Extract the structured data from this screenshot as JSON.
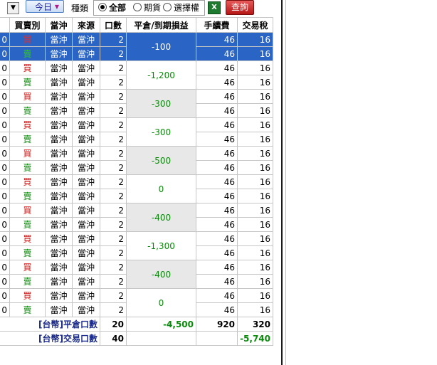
{
  "toolbar": {
    "dropdown_arrow": "▼",
    "today_label": "今日",
    "today_arrow": "▼",
    "kind_label": "種類",
    "radios": [
      {
        "label": "全部",
        "checked": true
      },
      {
        "label": "期貨",
        "checked": false
      },
      {
        "label": "選擇權",
        "checked": false
      }
    ],
    "excel_icon": "excel-icon",
    "query_label": "查詢"
  },
  "table": {
    "headers": {
      "first": "",
      "bs": "買賣別",
      "type": "當沖",
      "source": "來源",
      "qty": "口數",
      "pl": "平倉/到期損益",
      "fee": "手續費",
      "tax": "交易稅"
    },
    "rows": [
      {
        "first": "0",
        "bs": "買",
        "type": "當沖",
        "source": "當沖",
        "qty": "2",
        "fee": "46",
        "tax": "16"
      },
      {
        "first": "0",
        "bs": "賣",
        "type": "當沖",
        "source": "當沖",
        "qty": "2",
        "fee": "46",
        "tax": "16"
      },
      {
        "first": "0",
        "bs": "買",
        "type": "當沖",
        "source": "當沖",
        "qty": "2",
        "fee": "46",
        "tax": "16"
      },
      {
        "first": "0",
        "bs": "賣",
        "type": "當沖",
        "source": "當沖",
        "qty": "2",
        "fee": "46",
        "tax": "16"
      },
      {
        "first": "0",
        "bs": "買",
        "type": "當沖",
        "source": "當沖",
        "qty": "2",
        "fee": "46",
        "tax": "16"
      },
      {
        "first": "0",
        "bs": "賣",
        "type": "當沖",
        "source": "當沖",
        "qty": "2",
        "fee": "46",
        "tax": "16"
      },
      {
        "first": "0",
        "bs": "買",
        "type": "當沖",
        "source": "當沖",
        "qty": "2",
        "fee": "46",
        "tax": "16"
      },
      {
        "first": "0",
        "bs": "賣",
        "type": "當沖",
        "source": "當沖",
        "qty": "2",
        "fee": "46",
        "tax": "16"
      },
      {
        "first": "0",
        "bs": "買",
        "type": "當沖",
        "source": "當沖",
        "qty": "2",
        "fee": "46",
        "tax": "16"
      },
      {
        "first": "0",
        "bs": "賣",
        "type": "當沖",
        "source": "當沖",
        "qty": "2",
        "fee": "46",
        "tax": "16"
      },
      {
        "first": "0",
        "bs": "買",
        "type": "當沖",
        "source": "當沖",
        "qty": "2",
        "fee": "46",
        "tax": "16"
      },
      {
        "first": "0",
        "bs": "賣",
        "type": "當沖",
        "source": "當沖",
        "qty": "2",
        "fee": "46",
        "tax": "16"
      },
      {
        "first": "0",
        "bs": "買",
        "type": "當沖",
        "source": "當沖",
        "qty": "2",
        "fee": "46",
        "tax": "16"
      },
      {
        "first": "0",
        "bs": "賣",
        "type": "當沖",
        "source": "當沖",
        "qty": "2",
        "fee": "46",
        "tax": "16"
      },
      {
        "first": "0",
        "bs": "買",
        "type": "當沖",
        "source": "當沖",
        "qty": "2",
        "fee": "46",
        "tax": "16"
      },
      {
        "first": "0",
        "bs": "賣",
        "type": "當沖",
        "source": "當沖",
        "qty": "2",
        "fee": "46",
        "tax": "16"
      },
      {
        "first": "0",
        "bs": "買",
        "type": "當沖",
        "source": "當沖",
        "qty": "2",
        "fee": "46",
        "tax": "16"
      },
      {
        "first": "0",
        "bs": "賣",
        "type": "當沖",
        "source": "當沖",
        "qty": "2",
        "fee": "46",
        "tax": "16"
      },
      {
        "first": "0",
        "bs": "買",
        "type": "當沖",
        "source": "當沖",
        "qty": "2",
        "fee": "46",
        "tax": "16"
      },
      {
        "first": "0",
        "bs": "賣",
        "type": "當沖",
        "source": "當沖",
        "qty": "2",
        "fee": "46",
        "tax": "16"
      }
    ],
    "pl_groups": [
      "-100",
      "-1,200",
      "-300",
      "-300",
      "-500",
      "0",
      "-400",
      "-1,300",
      "-400",
      "0"
    ],
    "totals": {
      "close_label": "[台幣]平倉口數",
      "close_qty": "20",
      "close_pl": "-4,500",
      "close_fee": "920",
      "close_tax": "320",
      "trade_label": "[台幣]交易口數",
      "trade_qty": "40",
      "trade_tax": "-5,740"
    }
  },
  "colors": {
    "selected_row": "#2a64c5",
    "buy": "#d01818",
    "sell": "#128a12",
    "profit_loss": "#0a8a0a"
  }
}
